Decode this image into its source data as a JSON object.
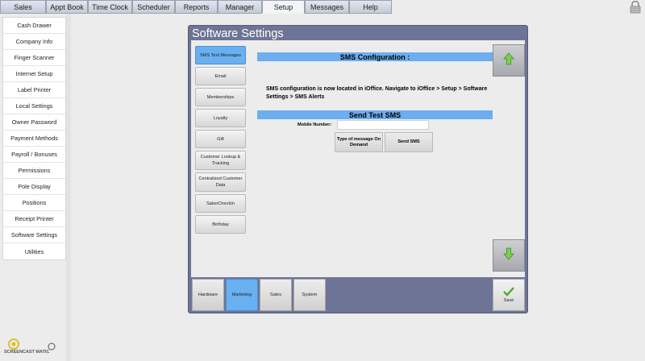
{
  "nav": {
    "tabs": [
      "Sales",
      "Appt Book",
      "Time Clock",
      "Scheduler",
      "Reports",
      "Manager",
      "Setup",
      "Messages",
      "Help"
    ],
    "active": "Setup"
  },
  "sidebar": {
    "items": [
      "Cash Drawer",
      "Company Info",
      "Finger Scanner",
      "Internet Setup",
      "Label Printer",
      "Local Settings",
      "Owner Password",
      "Payment Methods",
      "Payroll / Bonuses",
      "Permissions",
      "Pole Display",
      "Positions",
      "Receipt Printer",
      "Software Settings",
      "Utilities"
    ]
  },
  "panel": {
    "title": "Software Settings",
    "subtabs": [
      "SMS Text Messages",
      "Email",
      "Memberships",
      "Loyalty",
      "Gift",
      "Customer Lookup & Tracking",
      "Centralized Customer Data",
      "SalonCheckIn",
      "Birthday"
    ],
    "active_subtab": "SMS Text Messages",
    "sms_config": {
      "heading": "SMS Configuration :",
      "text": "SMS configuration is now located in iOffice. Navigate to iOffice > Setup > Software Settings > SMS Alerts"
    },
    "send_test": {
      "heading": "Send Test SMS",
      "mobile_label": "Mobile Number:",
      "mobile_value": "",
      "type_button": "Type of message On Demand",
      "send_button": "Send SMS"
    },
    "bottom_tabs": [
      "Hardware",
      "Marketing",
      "Sales",
      "System"
    ],
    "active_bottom_tab": "Marketing",
    "save_label": "Save"
  },
  "watermark": {
    "text": "SCREENCAST MATIC"
  },
  "colors": {
    "panel": "#6e7495",
    "highlight": "#6caef0",
    "active_tab": "#69b0f1"
  }
}
